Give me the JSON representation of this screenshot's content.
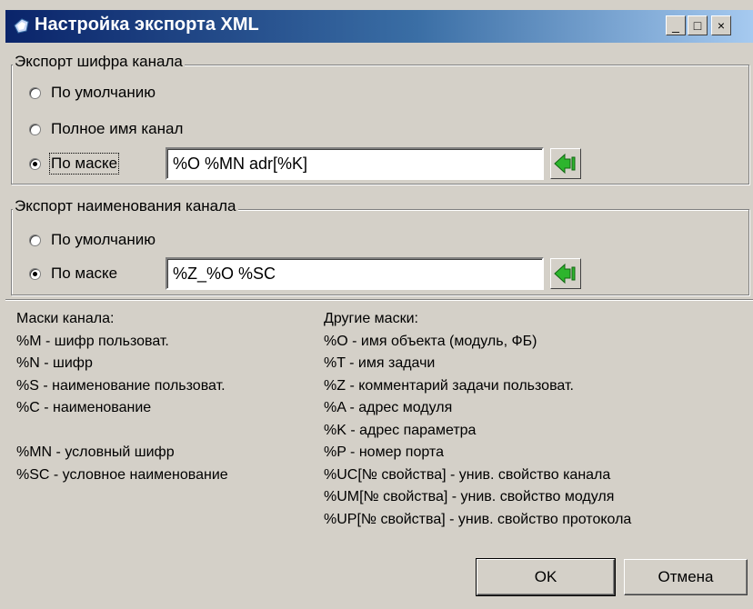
{
  "window": {
    "title": "Настройка экспорта XML",
    "controls": {
      "minimize": "_",
      "maximize": "□",
      "close": "×"
    }
  },
  "channel_code": {
    "legend": "Экспорт шифра канала",
    "options": [
      {
        "label": "По умолчанию",
        "selected": false
      },
      {
        "label": "Полное имя канал",
        "selected": false
      },
      {
        "label": "По маске",
        "selected": true
      }
    ],
    "mask_value": "%O %MN adr[%K]",
    "insert_icon": "green-left-arrow-icon"
  },
  "channel_name": {
    "legend": "Экспорт наименования канала",
    "options": [
      {
        "label": "По умолчанию",
        "selected": false
      },
      {
        "label": "По маске",
        "selected": true
      }
    ],
    "mask_value": "%Z_%O %SC",
    "insert_icon": "green-left-arrow-icon"
  },
  "help_left": {
    "heading": "Маски канала:",
    "lines": [
      "%M - шифр пользоват.",
      "%N - шифр",
      "%S - наименование пользоват.",
      "%C - наименование",
      "",
      "%MN - условный шифр",
      "%SC -  условное наименование"
    ]
  },
  "help_right": {
    "heading": "Другие маски:",
    "lines": [
      "%O - имя объекта (модуль, ФБ)",
      "%T - имя задачи",
      "%Z - комментарий задачи пользоват.",
      "%A - адрес модуля",
      "%K - адрес параметра",
      "%P - номер порта",
      "%UC[№ свойства] - унив. свойство канала",
      "%UM[№ свойства] - унив. свойство модуля",
      "%UP[№ свойства] - унив. свойство протокола"
    ]
  },
  "buttons": {
    "ok": "OK",
    "cancel": "Отмена"
  },
  "colors": {
    "title_start": "#0a246a",
    "title_end": "#a6caf0",
    "face": "#d4d0c8",
    "arrow_green": "#2db52d"
  }
}
